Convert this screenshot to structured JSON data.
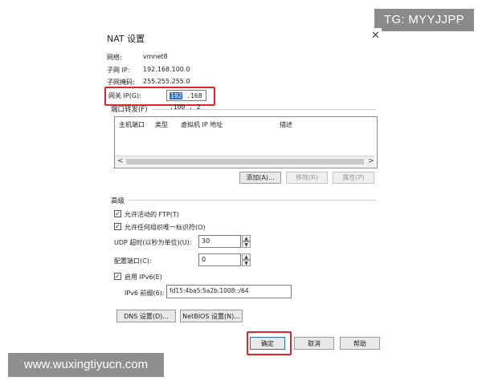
{
  "watermarks": {
    "top": "TG: MYYJJPP",
    "bottom": "www.wuxingtiyucn.com"
  },
  "dialog": {
    "title": "NAT 设置",
    "close_glyph": "✕"
  },
  "info": {
    "network_label": "网络:",
    "network_value": "vmnet8",
    "subnet_ip_label": "子网 IP:",
    "subnet_ip_value": "192.168.100.0",
    "subnet_mask_label": "子网掩码:",
    "subnet_mask_value": "255.255.255.0",
    "gateway_label": "网关 IP(G):",
    "gateway_value": {
      "selected": "192",
      "rest": " .168 .100 . 2"
    }
  },
  "port_forwarding": {
    "group_label": "端口转发(F)",
    "columns": [
      "主机端口",
      "类型",
      "虚拟机 IP 地址",
      "描述"
    ],
    "rows": [],
    "scroll_left": "<",
    "scroll_right": ">",
    "add_button": "添加(A)...",
    "remove_button": "移除(R)",
    "properties_button": "属性(P)"
  },
  "advanced": {
    "group_label": "高级",
    "allow_ftp_label": "允许活动的 FTP(T)",
    "allow_ftp_checked": true,
    "allow_oui_label": "允许任何组织唯一标识符(O)",
    "allow_oui_checked": true,
    "udp_timeout_label": "UDP 超时(以秒为单位)(U):",
    "udp_timeout_value": "30",
    "config_port_label": "配置端口(C):",
    "config_port_value": "0",
    "enable_ipv6_label": "启用 IPv6(E)",
    "enable_ipv6_checked": true,
    "ipv6_prefix_label": "IPv6 前缀(6):",
    "ipv6_prefix_value": "fd15:4ba5:5a2b:1008::/64",
    "dns_button": "DNS 设置(D)...",
    "netbios_button": "NetBIOS 设置(N)..."
  },
  "footer": {
    "ok_button": "确定",
    "cancel_button": "取消",
    "help_button": "帮助"
  },
  "colors": {
    "highlight": "#e0262a",
    "selection": "#2a6fd6"
  }
}
